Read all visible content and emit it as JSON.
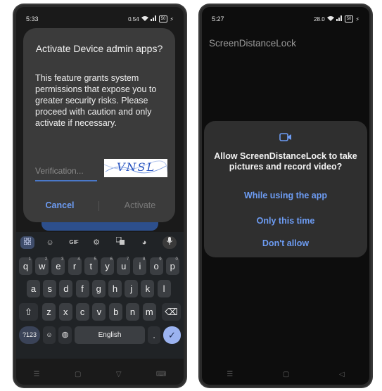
{
  "left": {
    "status": {
      "time": "5:33",
      "net_speed": "0.54",
      "battery": "50"
    },
    "dialog": {
      "title": "Activate Device admin apps?",
      "body": "This feature grants system permissions that expose you to greater security risks. Please proceed with caution and only activate if necessary.",
      "verification_placeholder": "Verification...",
      "captcha_text": "VNSL",
      "cancel_label": "Cancel",
      "activate_label": "Activate"
    },
    "keyboard": {
      "toolbar": [
        "apps-grid-icon",
        "sticker-icon",
        "GIF",
        "settings-icon",
        "translate-icon",
        "palette-icon",
        "mic-icon"
      ],
      "gif_label": "GIF",
      "row1": [
        {
          "k": "q",
          "s": "1"
        },
        {
          "k": "w",
          "s": "2"
        },
        {
          "k": "e",
          "s": "3"
        },
        {
          "k": "r",
          "s": "4"
        },
        {
          "k": "t",
          "s": "5"
        },
        {
          "k": "y",
          "s": "6"
        },
        {
          "k": "u",
          "s": "7"
        },
        {
          "k": "i",
          "s": "8"
        },
        {
          "k": "o",
          "s": "9"
        },
        {
          "k": "p",
          "s": "0"
        }
      ],
      "row2": [
        "a",
        "s",
        "d",
        "f",
        "g",
        "h",
        "j",
        "k",
        "l"
      ],
      "row3": [
        "z",
        "x",
        "c",
        "v",
        "b",
        "n",
        "m"
      ],
      "symbols_label": "?123",
      "space_label": "English",
      "period_label": "."
    }
  },
  "right": {
    "status": {
      "time": "5:27",
      "net_speed": "28.0",
      "battery": "50"
    },
    "app_title": "ScreenDistanceLock",
    "dialog": {
      "title": "Allow ScreenDistanceLock to take pictures and record video?",
      "option_while_using": "While using the app",
      "option_only_this_time": "Only this time",
      "option_dont_allow": "Don't allow"
    }
  },
  "colors": {
    "accent": "#6d9cf3",
    "dialog_bg": "#3b3b3b",
    "keyboard_bg": "#202326"
  }
}
